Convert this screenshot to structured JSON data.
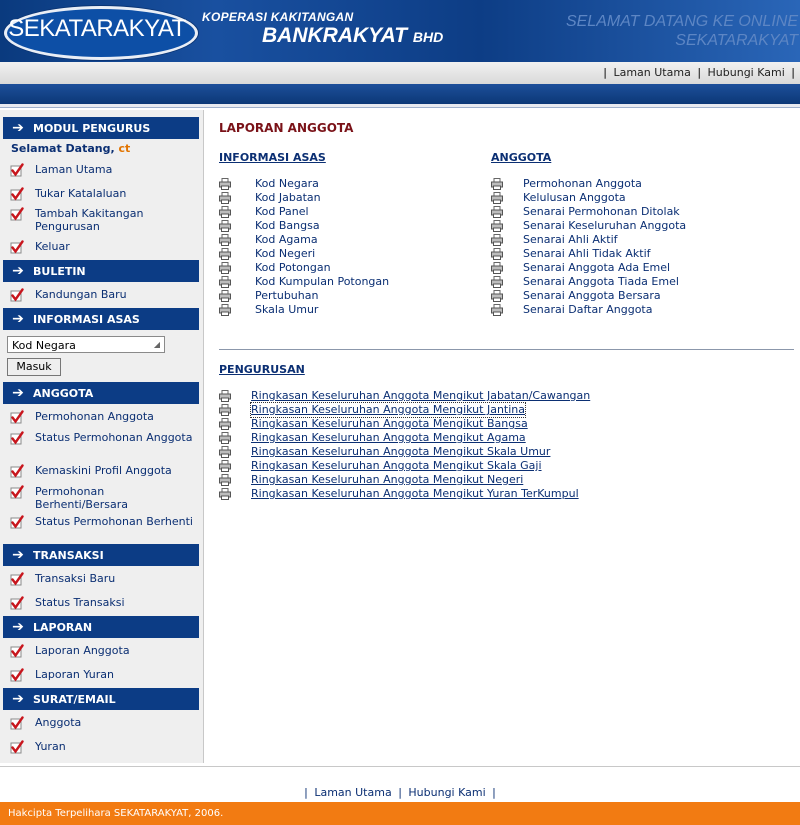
{
  "header": {
    "logo": "SEKATARAKYAT",
    "line1": "KOPERASI KAKITANGAN",
    "line2_main": "BANKRAKYAT",
    "line2_suffix": "BHD",
    "welcome_line1": "SELAMAT DATANG KE ONLINE",
    "welcome_line2": "SEKATARAKYAT"
  },
  "topnav": {
    "sep": "|",
    "links": [
      "Laman Utama",
      "Hubungi Kami"
    ]
  },
  "sidebar": {
    "sections": [
      {
        "title": "MODUL PENGURUS"
      },
      {
        "title": "BULETIN"
      },
      {
        "title": "INFORMASI ASAS"
      },
      {
        "title": "ANGGOTA"
      },
      {
        "title": "TRANSAKSI"
      },
      {
        "title": "LAPORAN"
      },
      {
        "title": "SURAT/EMAIL"
      }
    ],
    "welcome_label": "Selamat Datang,",
    "welcome_user": "ct",
    "modul_items": [
      "Laman Utama",
      "Tukar Katalaluan",
      "Tambah Kakitangan Pengurusan",
      "Keluar"
    ],
    "buletin_items": [
      "Kandungan Baru"
    ],
    "info_select": "Kod Negara",
    "info_button": "Masuk",
    "anggota_items": [
      "Permohonan Anggota",
      "Status Permohonan Anggota",
      "Kemaskini Profil Anggota",
      "Permohonan Berhenti/Bersara",
      "Status Permohonan Berhenti"
    ],
    "transaksi_items": [
      "Transaksi Baru",
      "Status Transaksi"
    ],
    "laporan_items": [
      "Laporan Anggota",
      "Laporan Yuran"
    ],
    "surat_items": [
      "Anggota",
      "Yuran"
    ]
  },
  "main": {
    "title": "LAPORAN ANGGOTA",
    "info_title": "INFORMASI ASAS",
    "info_links": [
      "Kod Negara",
      "Kod Jabatan",
      "Kod Panel",
      "Kod Bangsa",
      "Kod Agama",
      "Kod Negeri",
      "Kod Potongan",
      "Kod Kumpulan Potongan",
      "Pertubuhan",
      "Skala Umur"
    ],
    "anggota_title": "ANGGOTA",
    "anggota_links": [
      "Permohonan Anggota",
      "Kelulusan Anggota",
      "Senarai Permohonan Ditolak",
      "Senarai Keseluruhan Anggota",
      "Senarai Ahli Aktif",
      "Senarai Ahli Tidak Aktif",
      "Senarai Anggota Ada Emel",
      "Senarai Anggota Tiada Emel",
      "Senarai Anggota Bersara",
      "Senarai Daftar Anggota"
    ],
    "pengurusan_title": "PENGURUSAN",
    "pengurusan_links": [
      "Ringkasan Keseluruhan Anggota Mengikut Jabatan/Cawangan",
      "Ringkasan Keseluruhan Anggota Mengikut Jantina",
      "Ringkasan Keseluruhan Anggota Mengikut Bangsa",
      "Ringkasan Keseluruhan Anggota Mengikut Agama",
      "Ringkasan Keseluruhan Anggota Mengikut Skala Umur",
      "Ringkasan Keseluruhan Anggota Mengikut Skala Gaji",
      "Ringkasan Keseluruhan Anggota Mengikut Negeri",
      "Ringkasan Keseluruhan Anggota Mengikut Yuran TerKumpul"
    ]
  },
  "footer": {
    "sep": "|",
    "links": [
      "Laman Utama",
      "Hubungi Kami"
    ],
    "copyright": "Hakcipta Terpelihara SEKATARAKYAT, 2006."
  },
  "colors": {
    "navy": "#0c3c85",
    "title_red": "#7a1218",
    "link_blue": "#0b2f73",
    "orange": "#f27b12",
    "check_red": "#c8161d"
  },
  "icons": {
    "section_arrow": "arrow-right-icon",
    "menu_check": "red-checkmark-icon",
    "report_link": "printer-icon"
  }
}
